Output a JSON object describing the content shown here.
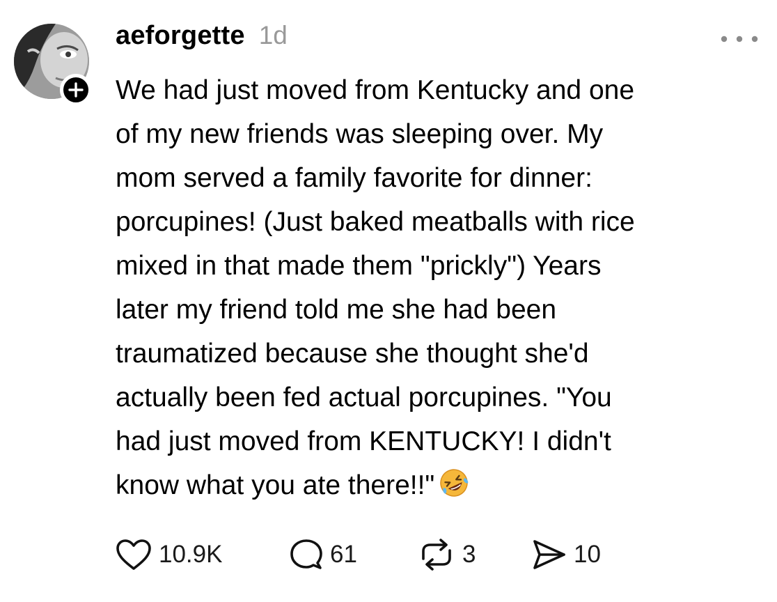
{
  "post": {
    "username": "aeforgette",
    "timestamp": "1d",
    "body_lines": [
      "We had just moved from Kentucky and one",
      "of my new friends was sleeping over. My",
      "mom served a family favorite for dinner:",
      "porcupines! (Just baked meatballs with rice",
      "mixed in that made them \"prickly\") Years",
      "later my friend told me she had been",
      "traumatized because she thought she'd",
      "actually been fed actual porcupines. \"You",
      "had just moved from KENTUCKY! I didn't",
      "know what you ate there!!\""
    ],
    "emoji": "rolling-on-floor-laughing-emoji"
  },
  "actions": {
    "likes": "10.9K",
    "replies": "61",
    "reposts": "3",
    "shares": "10"
  },
  "icons": {
    "like": "heart-icon",
    "reply": "speech-bubble-icon",
    "repost": "repost-icon",
    "share": "send-icon",
    "more": "more-dots-icon",
    "follow": "plus-icon"
  },
  "colors": {
    "text": "#000000",
    "muted": "#999999",
    "badge": "#000000",
    "emoji": "#F5B73A"
  }
}
